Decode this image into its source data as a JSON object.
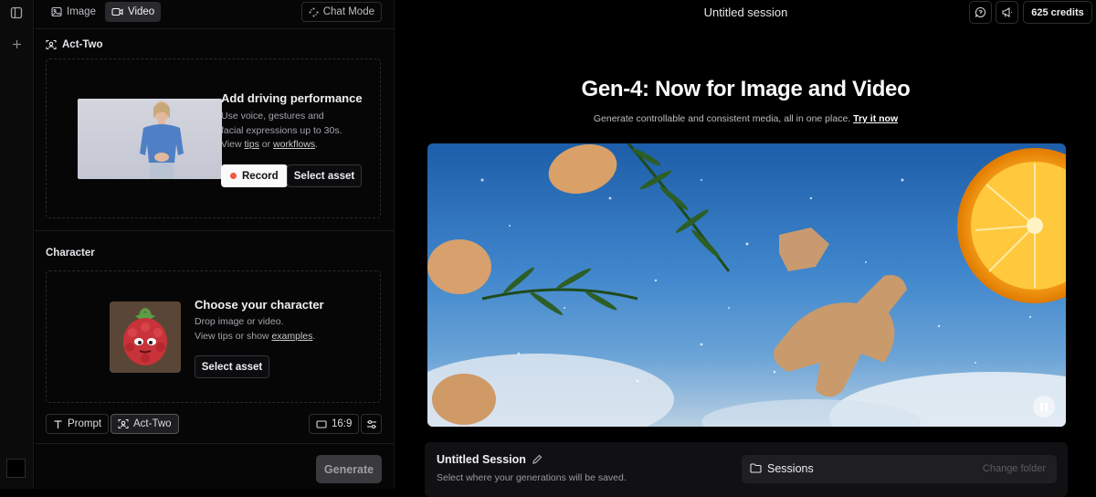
{
  "sidebar_rail": {
    "toggle_icon": "sidebar-toggle-icon",
    "add_icon": "plus-icon"
  },
  "panel": {
    "tabs": [
      {
        "label": "Image",
        "icon": "image-icon"
      },
      {
        "label": "Video",
        "icon": "video-camera-icon"
      }
    ],
    "chat_mode_label": "Chat Mode",
    "act_two": {
      "section_title": "Act-Two",
      "card_title": "Add driving performance",
      "desc_line1": "Use voice, gestures and",
      "desc_line2": "facial expressions up to 30s.",
      "desc_prefix": "View ",
      "link_tips": "tips",
      "desc_or": " or ",
      "link_workflows": "workflows",
      "desc_end": ".",
      "record_label": "Record",
      "select_asset_label": "Select asset"
    },
    "character": {
      "section_title": "Character",
      "card_title": "Choose your character",
      "desc_line1": "Drop image or video.",
      "desc_prefix": "View tips or show ",
      "link_examples": "examples",
      "desc_end": ".",
      "select_asset_label": "Select asset"
    },
    "toolbar": {
      "prompt_label": "Prompt",
      "act_two_label": "Act-Two",
      "aspect_label": "16:9",
      "settings_icon": "sliders-icon"
    },
    "generate_label": "Generate"
  },
  "main": {
    "session_title": "Untitled session",
    "credits_label": "625 credits",
    "hero_title": "Gen-4: Now for Image and Video",
    "hero_sub": "Generate controllable and consistent media, all in one place.",
    "hero_link": "Try it now",
    "bottom": {
      "title": "Untitled Session",
      "subtitle": "Select where your generations will be saved.",
      "sessions_label": "Sessions",
      "change_folder_label": "Change folder"
    }
  },
  "colors": {
    "accent_record": "#ef5a3c",
    "background": "#000000",
    "panel": "#060607"
  }
}
